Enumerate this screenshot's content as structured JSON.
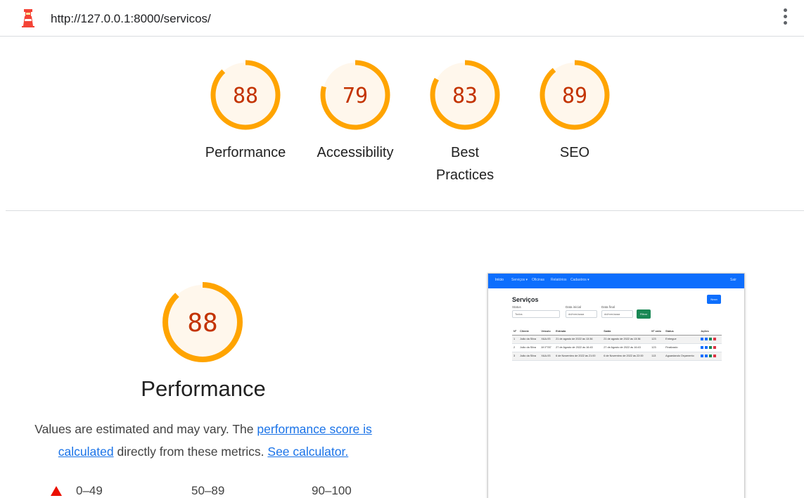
{
  "header": {
    "url": "http://127.0.0.1:8000/servicos/",
    "app_icon": "lighthouse-icon",
    "menu_icon": "kebab-menu-icon"
  },
  "colors": {
    "gauge_average_stroke": "#ffa400",
    "gauge_average_text": "#c33300",
    "gauge_average_bg": "#fff7ec",
    "link": "#1a73e8",
    "fail": "#eb0f00",
    "thumb_nav": "#0d6efd"
  },
  "scores": [
    {
      "id": "performance",
      "value": 88,
      "label": "Performance"
    },
    {
      "id": "accessibility",
      "value": 79,
      "label": "Accessibility"
    },
    {
      "id": "best-practices",
      "value": 83,
      "label": "Best Practices"
    },
    {
      "id": "seo",
      "value": 89,
      "label": "SEO"
    }
  ],
  "performance_section": {
    "score": 88,
    "title": "Performance",
    "desc_prefix": "Values are estimated and may vary. The ",
    "desc_link1": "performance score is calculated",
    "desc_middle": " directly from these metrics. ",
    "desc_link2": "See calculator."
  },
  "legend": {
    "fail": "0–49",
    "average": "50–89",
    "pass": "90–100"
  },
  "thumbnail": {
    "nav": [
      "Início",
      "Serviços ▾",
      "Oficinas",
      "Relatórios",
      "Cadastros ▾",
      "Sair"
    ],
    "title": "Serviços",
    "new_button": "Novo",
    "filters": {
      "status_label": "Status",
      "status_value": "Todos",
      "start_label": "Data inicial",
      "start_value": "dd/mm/aaaa",
      "end_label": "Data final",
      "end_value": "dd/mm/aaaa",
      "filter_button": "Filtrar"
    },
    "columns": [
      "Nº",
      "Cliente",
      "Veículo",
      "Entrada",
      "Saída",
      "Nº ordo",
      "Status",
      "Ações"
    ],
    "rows": [
      [
        "1",
        "João da Silva",
        "XAA-93",
        "21 de agosto de 2022 às 13:36",
        "21 de agosto de 2022 às 13:36",
        "123",
        "Entregue"
      ],
      [
        "2",
        "João da Silva",
        "AY-F787",
        "27 de Agosto de 2022 às 16:43",
        "27 de Agosto de 2022 às 16:43",
        "123",
        "Finalizado"
      ],
      [
        "3",
        "João da Silva",
        "XAA-93",
        "6 de Novembro de 2022 às 21:00",
        "6 de Novembro de 2022 às 22:00",
        "113",
        "Aguardando Orçamento"
      ]
    ]
  }
}
